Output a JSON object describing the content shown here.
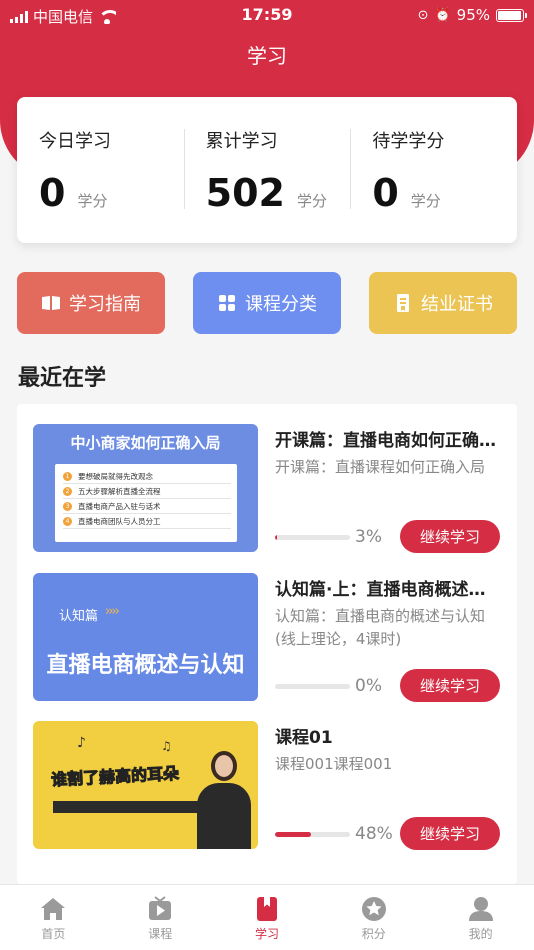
{
  "status_bar": {
    "carrier": "中国电信",
    "time": "17:59",
    "battery_percent": "95%",
    "battery_level": 0.95
  },
  "page_title": "学习",
  "stats": [
    {
      "label": "今日学习",
      "value": "0",
      "unit": "学分"
    },
    {
      "label": "累计学习",
      "value": "502",
      "unit": "学分"
    },
    {
      "label": "待学学分",
      "value": "0",
      "unit": "学分"
    }
  ],
  "actions": [
    {
      "label": "学习指南",
      "icon": "book-icon",
      "color": "#e26b5d"
    },
    {
      "label": "课程分类",
      "icon": "grid-icon",
      "color": "#6f8ff0"
    },
    {
      "label": "结业证书",
      "icon": "certificate-icon",
      "color": "#ebc454"
    }
  ],
  "section_title": "最近在学",
  "courses": [
    {
      "title": "开课篇：直播电商如何正确入局",
      "desc": "开课篇：直播课程如何正确入局",
      "progress": 0.03,
      "progress_text": "3%",
      "button": "继续学习",
      "thumb": {
        "heading": "中小商家如何正确入局",
        "items": [
          {
            "num": "1",
            "text": "要想破局就得先改观念"
          },
          {
            "num": "2",
            "text": "五大步骤解析直播全流程"
          },
          {
            "num": "3",
            "text": "直播电商产品入驻与话术"
          },
          {
            "num": "4",
            "text": "直播电商团队与人员分工"
          }
        ]
      }
    },
    {
      "title": "认知篇·上：直播电商概述与认知",
      "desc": "认知篇：直播电商的概述与认知(线上理论，4课时)",
      "progress": 0.0,
      "progress_text": "0%",
      "button": "继续学习",
      "thumb": {
        "tag": "认知篇",
        "arrows": "››››",
        "heading": "直播电商概述与认知"
      }
    },
    {
      "title": "课程01",
      "desc": "课程001课程001",
      "progress": 0.48,
      "progress_text": "48%",
      "button": "继续学习",
      "thumb": {
        "heading": "谁割了赫高的耳朵",
        "note1": "♪",
        "note2": "♫"
      }
    }
  ],
  "tabs": [
    {
      "label": "首页",
      "icon": "home-icon",
      "active": false
    },
    {
      "label": "课程",
      "icon": "video-icon",
      "active": false
    },
    {
      "label": "学习",
      "icon": "bookmark-icon",
      "active": true
    },
    {
      "label": "积分",
      "icon": "star-icon",
      "active": false
    },
    {
      "label": "我的",
      "icon": "user-icon",
      "active": false
    }
  ],
  "colors": {
    "brand_red": "#d52d44",
    "inactive_gray": "#999999"
  }
}
